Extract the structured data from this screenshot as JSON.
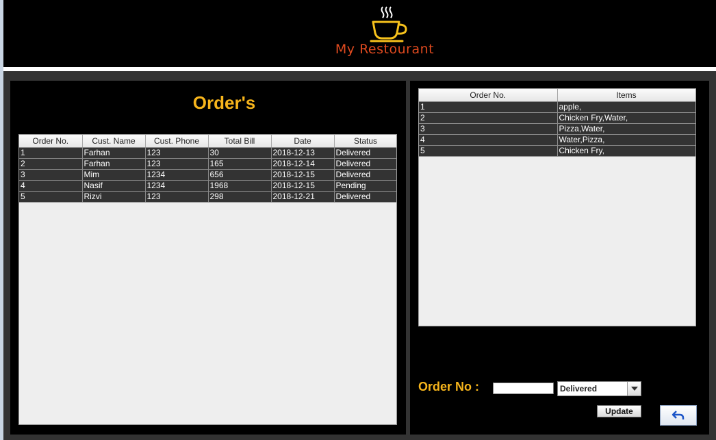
{
  "header": {
    "brand_name": "My Restourant",
    "logo_icon": "coffee-cup-icon",
    "brand_color": "#e04a1f",
    "logo_color": "#f7c21c"
  },
  "orders_panel": {
    "title": "Order's",
    "columns": [
      "Order No.",
      "Cust. Name",
      "Cust. Phone",
      "Total Bill",
      "Date",
      "Status"
    ],
    "rows": [
      [
        "1",
        "Farhan",
        "123",
        "30",
        "2018-12-13",
        "Delivered"
      ],
      [
        "2",
        "Farhan",
        "123",
        "165",
        "2018-12-14",
        "Delivered"
      ],
      [
        "3",
        "Mim",
        "1234",
        "656",
        "2018-12-15",
        "Delivered"
      ],
      [
        "4",
        "Nasif",
        "1234",
        "1968",
        "2018-12-15",
        "Pending"
      ],
      [
        "5",
        "Rizvi",
        "123",
        "298",
        "2018-12-21",
        "Delivered"
      ]
    ]
  },
  "items_panel": {
    "columns": [
      "Order No.",
      "Items"
    ],
    "rows": [
      [
        "1",
        "apple,"
      ],
      [
        "2",
        "Chicken Fry,Water,"
      ],
      [
        "3",
        "Pizza,Water,"
      ],
      [
        "4",
        "Water,Pizza,"
      ],
      [
        "5",
        "Chicken Fry,"
      ]
    ]
  },
  "update_form": {
    "order_no_label": "Order No :",
    "order_no_value": "",
    "status_selected": "Delivered",
    "update_label": "Update",
    "back_icon": "undo-arrow-icon"
  },
  "colors": {
    "accent": "#f7b51c",
    "panel_bg": "#000000",
    "row_bg": "#333333"
  }
}
